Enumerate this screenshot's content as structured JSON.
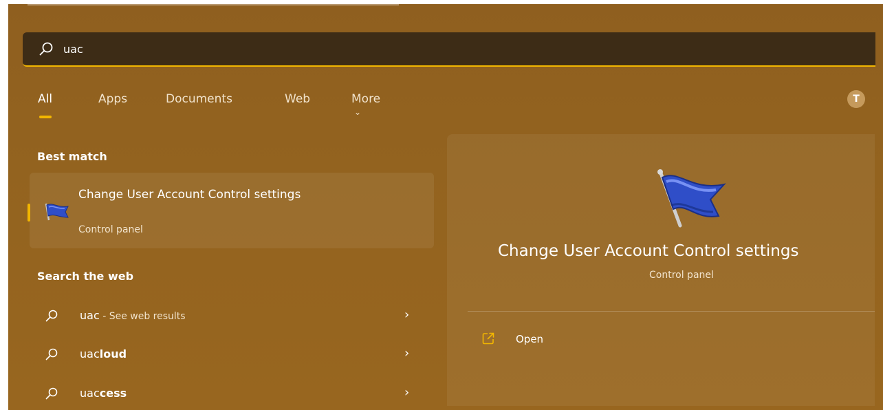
{
  "search": {
    "query": "uac"
  },
  "tabs": [
    {
      "label": "All"
    },
    {
      "label": "Apps"
    },
    {
      "label": "Documents"
    },
    {
      "label": "Web"
    },
    {
      "label": "More"
    }
  ],
  "account": {
    "initial": "T"
  },
  "best_match": {
    "heading": "Best match",
    "title": "Change User Account Control settings",
    "subtitle": "Control panel"
  },
  "web": {
    "heading": "Search the web",
    "results": [
      {
        "query": "uac",
        "suffix": " - See web results"
      },
      {
        "prefix": "uac",
        "completion": "loud"
      },
      {
        "prefix": "uac",
        "completion": "cess"
      }
    ]
  },
  "detail": {
    "title": "Change User Account Control settings",
    "subtitle": "Control panel",
    "actions": [
      {
        "label": "Open"
      }
    ]
  },
  "colors": {
    "accent": "#f2b600",
    "background": "#93631f",
    "search_box": "#3d2c16"
  },
  "icons": [
    "search-icon",
    "chevron-down-icon",
    "chevron-right-icon",
    "uac-flag-icon",
    "open-external-icon"
  ]
}
